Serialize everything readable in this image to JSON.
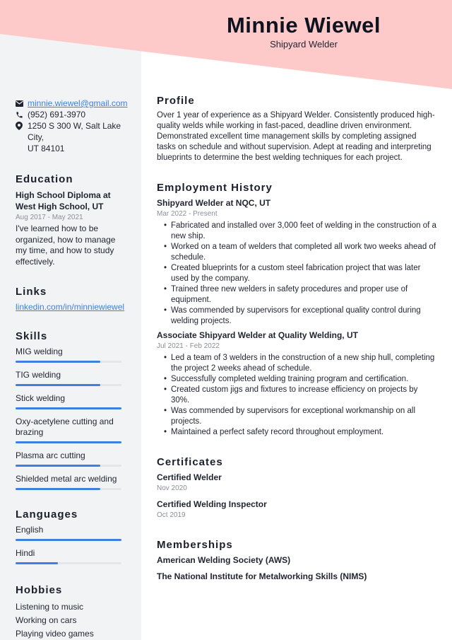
{
  "header": {
    "name": "Minnie Wiewel",
    "role": "Shipyard Welder"
  },
  "colors": {
    "header_bg": "#fec9c9",
    "sidebar_bg": "#f2f3f5",
    "accent": "#3e7fe0"
  },
  "contact": {
    "email": "minnie.wiewel@gmail.com",
    "phone": "(952) 691-3970",
    "address_line1": "1250 S 300 W, Salt Lake City,",
    "address_line2": "UT 84101"
  },
  "education": {
    "heading": "Education",
    "items": [
      {
        "title": "High School Diploma at West High School, UT",
        "dates": "Aug 2017 - May 2021",
        "description": "I've learned how to be organized, how to manage my time, and how to study effectively."
      }
    ]
  },
  "links": {
    "heading": "Links",
    "items": [
      {
        "label": "linkedin.com/in/minniewiewel"
      }
    ]
  },
  "skills": {
    "heading": "Skills",
    "items": [
      {
        "label": "MIG welding",
        "level": 0.8
      },
      {
        "label": "TIG welding",
        "level": 0.8
      },
      {
        "label": "Stick welding",
        "level": 1.0
      },
      {
        "label": "Oxy-acetylene cutting and brazing",
        "level": 1.0
      },
      {
        "label": "Plasma arc cutting",
        "level": 0.8
      },
      {
        "label": "Shielded metal arc welding",
        "level": 0.8
      }
    ]
  },
  "languages": {
    "heading": "Languages",
    "items": [
      {
        "label": "English",
        "level": 1.0
      },
      {
        "label": "Hindi",
        "level": 0.4
      }
    ]
  },
  "hobbies": {
    "heading": "Hobbies",
    "items": [
      "Listening to music",
      "Working on cars",
      "Playing video games"
    ]
  },
  "profile": {
    "heading": "Profile",
    "text": "Over 1 year of experience as a Shipyard Welder. Consistently produced high-quality welds while working in fast-paced, deadline driven environment. Demonstrated excellent time management skills by completing assigned tasks on schedule and without supervision. Adept at reading and interpreting blueprints to determine the best welding techniques for each project."
  },
  "employment": {
    "heading": "Employment History",
    "jobs": [
      {
        "title": "Shipyard Welder at NQC, UT",
        "dates": "Mar 2022 - Present",
        "bullets": [
          "Fabricated and installed over 3,000 feet of welding in the construction of a new ship.",
          "Worked on a team of welders that completed all work two weeks ahead of schedule.",
          "Created blueprints for a custom steel fabrication project that was later used by the company.",
          "Trained three new welders in safety procedures and proper use of equipment.",
          "Was commended by supervisors for exceptional quality control during welding projects."
        ]
      },
      {
        "title": "Associate Shipyard Welder at Quality Welding, UT",
        "dates": "Jul 2021 - Feb 2022",
        "bullets": [
          "Led a team of 3 welders in the construction of a new ship hull, completing the project 2 weeks ahead of schedule.",
          "Successfully completed welding training program and certification.",
          "Created custom jigs and fixtures to increase efficiency on projects by 30%.",
          "Was commended by supervisors for exceptional workmanship on all projects.",
          "Maintained a perfect safety record throughout employment."
        ]
      }
    ]
  },
  "certificates": {
    "heading": "Certificates",
    "items": [
      {
        "title": "Certified Welder",
        "date": "Nov 2020"
      },
      {
        "title": "Certified Welding Inspector",
        "date": "Oct 2019"
      }
    ]
  },
  "memberships": {
    "heading": "Memberships",
    "items": [
      "American Welding Society (AWS)",
      "The National Institute for Metalworking Skills (NIMS)"
    ]
  }
}
